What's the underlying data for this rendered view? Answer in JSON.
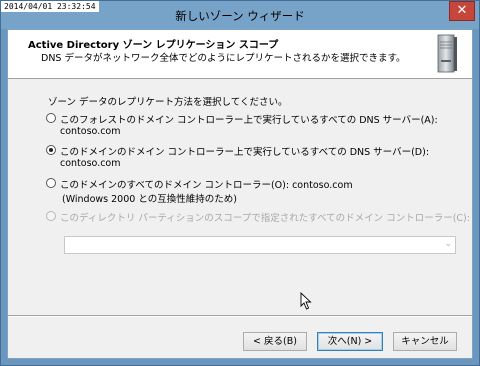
{
  "timestamp": "2014/04/01 23:32:54",
  "window": {
    "title": "新しいゾーン ウィザード",
    "close_glyph": "✕"
  },
  "header": {
    "title": "Active Directory ゾーン レプリケーション スコープ",
    "subtitle": "DNS データがネットワーク全体でどのようにレプリケートされるかを選択できます。",
    "icon": "server-icon"
  },
  "body": {
    "prompt": "ゾーン データのレプリケート方法を選択してください。",
    "options": [
      {
        "label": "このフォレストのドメイン コントローラー上で実行しているすべての DNS サーバー(A): contoso.com",
        "checked": false,
        "enabled": true
      },
      {
        "label": "このドメインのドメイン コントローラー上で実行しているすべての DNS サーバー(D): contoso.com",
        "checked": true,
        "enabled": true
      },
      {
        "label": "このドメインのすべてのドメイン コントローラー(O): contoso.com",
        "sublabel": "(Windows 2000 との互換性維持のため)",
        "checked": false,
        "enabled": true
      },
      {
        "label": "このディレクトリ パーティションのスコープで指定されたすべてのドメイン コントローラー(C):",
        "checked": false,
        "enabled": false
      }
    ],
    "partition_combo": {
      "value": ""
    }
  },
  "footer": {
    "back_label": "< 戻る(B)",
    "next_label": "次へ(N) >",
    "cancel_label": "キャンセル"
  }
}
